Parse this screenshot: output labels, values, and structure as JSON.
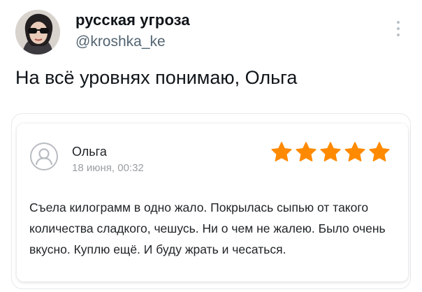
{
  "tweet": {
    "display_name": "русская угроза",
    "handle": "@kroshka_ke",
    "text": "На всё уровнях понимаю, Ольга",
    "menu_icon": "more-vertical-icon"
  },
  "review": {
    "reviewer_name": "Ольга",
    "date": "18 июня, 00:32",
    "rating": 5,
    "rating_max": 5,
    "star_color": "#ff8a00",
    "avatar_icon": "user-placeholder-icon",
    "text": "Съела килограмм в одно жало. Покрылась сыпью от такого количества сладкого, чешусь. Ни о чем не жалею. Было очень вкусно. Куплю ещё. И буду жрать и чесаться."
  }
}
